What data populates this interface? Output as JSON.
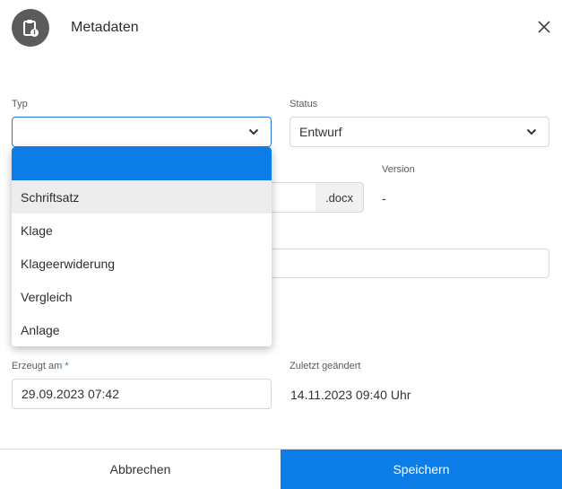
{
  "header": {
    "title": "Metadaten"
  },
  "fields": {
    "typ": {
      "label": "Typ",
      "value": ""
    },
    "status": {
      "label": "Status",
      "value": "Entwurf"
    },
    "version": {
      "label": "Version",
      "value": "-"
    },
    "extension": ".docx",
    "erzeugt_am": {
      "label": "Erzeugt am",
      "required_marker": "*",
      "value": "29.09.2023 07:42"
    },
    "zuletzt_geaendert": {
      "label": "Zuletzt geändert",
      "value": "14.11.2023 09:40 Uhr"
    }
  },
  "dropdown": {
    "options": [
      "",
      "Schriftsatz",
      "Klage",
      "Klageerwiderung",
      "Vergleich",
      "Anlage"
    ]
  },
  "footer": {
    "cancel_label": "Abbrechen",
    "save_label": "Speichern"
  },
  "colors": {
    "accent": "#0c7ce6",
    "header_icon_bg": "#5b5b5b"
  },
  "icons": {
    "header": "clipboard-info-icon",
    "close": "close-icon",
    "select": "chevron-down-icon"
  }
}
